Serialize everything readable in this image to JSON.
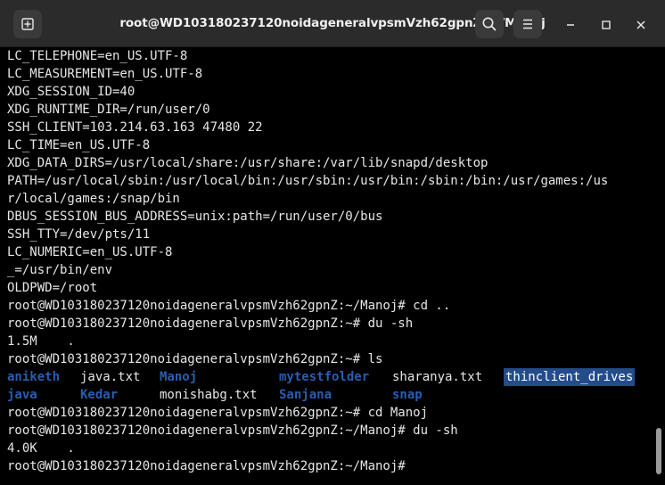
{
  "window": {
    "title": "root@WD103180237120noidageneralvpsmVzh62gpnZ: ~/Manoj"
  },
  "icons": {
    "new_tab": "new-tab-icon",
    "search": "search-icon",
    "menu": "hamburger-menu-icon",
    "minimize": "minimize-icon",
    "maximize": "maximize-icon",
    "close": "close-icon"
  },
  "terminal": {
    "lines": [
      "LC_TELEPHONE=en_US.UTF-8",
      "LC_MEASUREMENT=en_US.UTF-8",
      "XDG_SESSION_ID=40",
      "XDG_RUNTIME_DIR=/run/user/0",
      "SSH_CLIENT=103.214.63.163 47480 22",
      "LC_TIME=en_US.UTF-8",
      "XDG_DATA_DIRS=/usr/local/share:/usr/share:/var/lib/snapd/desktop",
      "PATH=/usr/local/sbin:/usr/local/bin:/usr/sbin:/usr/bin:/sbin:/bin:/usr/games:/us",
      "r/local/games:/snap/bin",
      "DBUS_SESSION_BUS_ADDRESS=unix:path=/run/user/0/bus",
      "SSH_TTY=/dev/pts/11",
      "LC_NUMERIC=en_US.UTF-8",
      "_=/usr/bin/env",
      "OLDPWD=/root",
      "root@WD103180237120noidageneralvpsmVzh62gpnZ:~/Manoj# cd ..",
      "root@WD103180237120noidageneralvpsmVzh62gpnZ:~# du -sh",
      "1.5M    .",
      "root@WD103180237120noidageneralvpsmVzh62gpnZ:~# ls"
    ],
    "ls_row1": {
      "c1": "aniketh",
      "c2": "java.txt",
      "c3": "Manoj",
      "c4": "mytestfolder",
      "c5": "sharanya.txt",
      "c6": "thinclient_drives"
    },
    "ls_row2": {
      "c1": "java",
      "c2": "Kedar",
      "c3": "monishabg.txt",
      "c4": "Sanjana",
      "c5": "snap"
    },
    "lines2": [
      "root@WD103180237120noidageneralvpsmVzh62gpnZ:~# cd Manoj",
      "root@WD103180237120noidageneralvpsmVzh62gpnZ:~/Manoj# du -sh",
      "4.0K    .",
      "root@WD103180237120noidageneralvpsmVzh62gpnZ:~/Manoj#"
    ]
  },
  "colors": {
    "directory": "#2a5db0",
    "selection": "#244b8a",
    "text": "#e6e6e6",
    "background": "#000000"
  }
}
